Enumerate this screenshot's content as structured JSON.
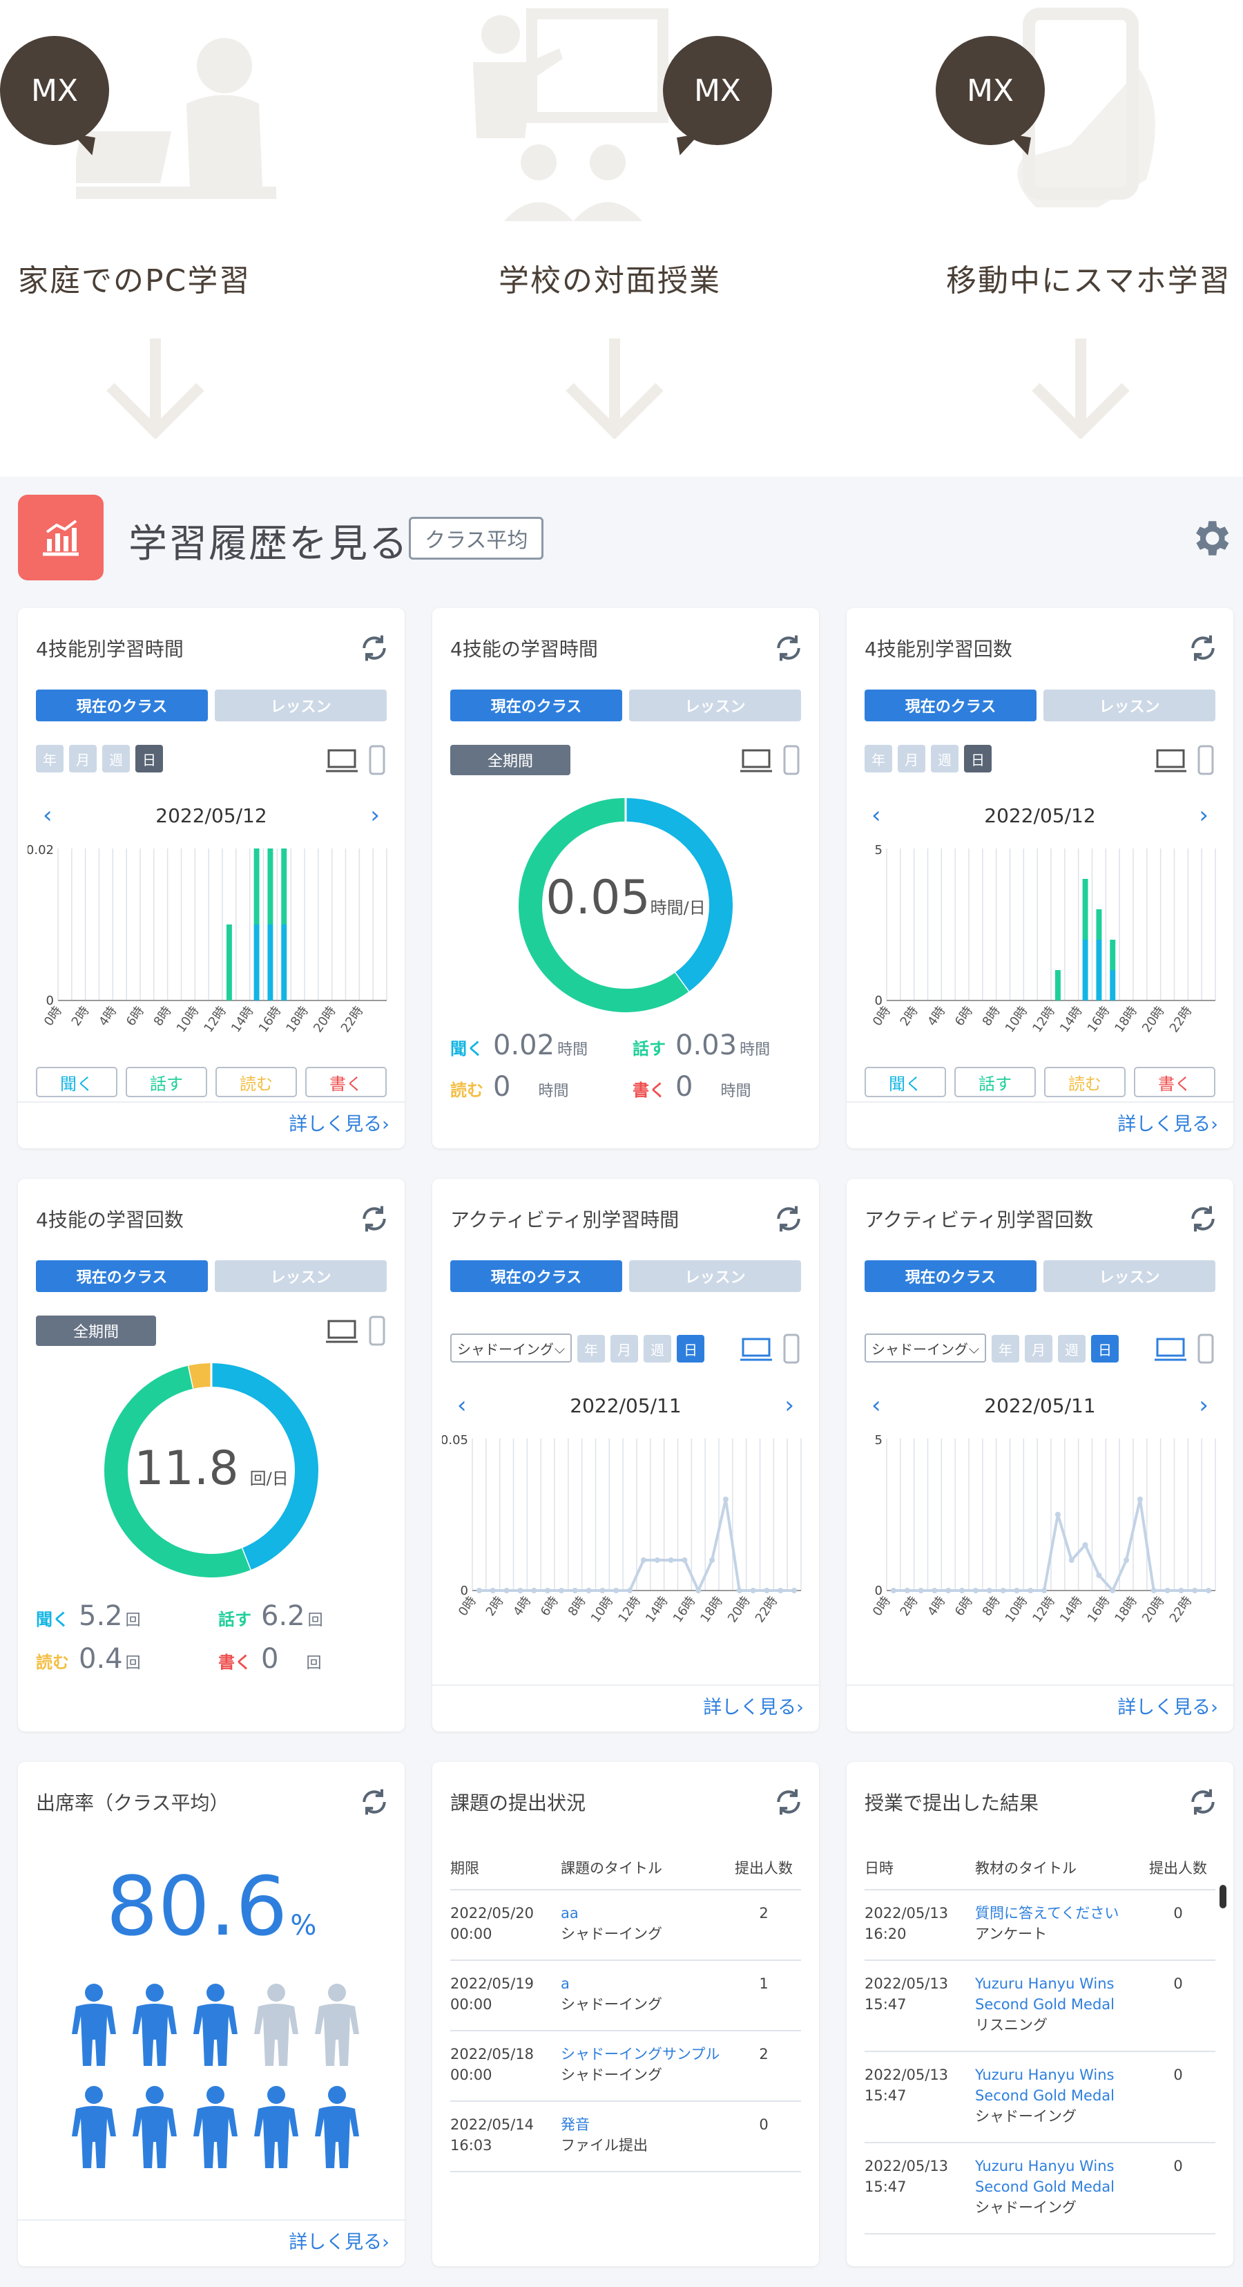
{
  "hero": {
    "columns": [
      {
        "bubble": "MX",
        "title": "家庭でのPC学習"
      },
      {
        "bubble": "MX",
        "title": "学校の対面授業"
      },
      {
        "bubble": "MX",
        "title": "移動中にスマホ学習"
      }
    ]
  },
  "dashboard": {
    "title": "学習履歴を見る",
    "badge": "クラス平均"
  },
  "common": {
    "tab_class": "現在のクラス",
    "tab_lesson": "レッスン",
    "period_year": "年",
    "period_month": "月",
    "period_week": "週",
    "period_day": "日",
    "all_period": "全期間",
    "more": "詳しく見る›",
    "prev": "‹",
    "next": "›",
    "skill_listen": "聞く",
    "skill_speak": "話す",
    "skill_read": "読む",
    "skill_write": "書く",
    "unit_time": "時間",
    "unit_count": "回",
    "hour_labels": [
      "0時",
      "2時",
      "4時",
      "6時",
      "8時",
      "10時",
      "12時",
      "14時",
      "16時",
      "18時",
      "20時",
      "22時"
    ]
  },
  "colors": {
    "listen": "#12b5e4",
    "speak": "#1fcf9a",
    "read": "#f3be43",
    "write": "#ef4f4f",
    "accent": "#2e7fdd"
  },
  "cards": {
    "c1": {
      "title": "4技能別学習時間",
      "date": "2022/05/12",
      "y_max": "0.02",
      "y_min": "0"
    },
    "c2": {
      "title": "4技能の学習時間",
      "center": "0.05",
      "center_unit": "時間/日",
      "listen": "0.02",
      "speak": "0.03",
      "read": "0",
      "write": "0"
    },
    "c3": {
      "title": "4技能別学習回数",
      "date": "2022/05/12",
      "y_max": "5",
      "y_min": "0"
    },
    "c4": {
      "title": "4技能の学習回数",
      "center": "11.8",
      "center_unit": "回/日",
      "listen": "5.2",
      "speak": "6.2",
      "read": "0.4",
      "write": "0"
    },
    "c5": {
      "title": "アクティビティ別学習時間",
      "select": "シャドーイング",
      "date": "2022/05/11",
      "y_max": "0.05",
      "y_min": "0"
    },
    "c6": {
      "title": "アクティビティ別学習回数",
      "select": "シャドーイング",
      "date": "2022/05/11",
      "y_max": "5",
      "y_min": "0"
    },
    "c7": {
      "title": "出席率（クラス平均）",
      "rate": "80.6",
      "rate_unit": "%"
    },
    "c8": {
      "title": "課題の提出状況",
      "headers": [
        "期限",
        "課題のタイトル",
        "提出人数"
      ],
      "rows": [
        {
          "date": "2022/05/20",
          "time": "00:00",
          "title": "aa",
          "type": "シャドーイング",
          "count": "2"
        },
        {
          "date": "2022/05/19",
          "time": "00:00",
          "title": "a",
          "type": "シャドーイング",
          "count": "1"
        },
        {
          "date": "2022/05/18",
          "time": "00:00",
          "title": "シャドーイングサンプル",
          "type": "シャドーイング",
          "count": "2"
        },
        {
          "date": "2022/05/14",
          "time": "16:03",
          "title": "発音",
          "type": "ファイル提出",
          "count": "0"
        }
      ]
    },
    "c9": {
      "title": "授業で提出した結果",
      "headers": [
        "日時",
        "教材のタイトル",
        "提出人数"
      ],
      "rows": [
        {
          "date": "2022/05/13",
          "time": "16:20",
          "title": "質問に答えてください",
          "type": "アンケート",
          "count": "0"
        },
        {
          "date": "2022/05/13",
          "time": "15:47",
          "title": "Yuzuru Hanyu Wins Second Gold Medal",
          "type": "リスニング",
          "count": "0"
        },
        {
          "date": "2022/05/13",
          "time": "15:47",
          "title": "Yuzuru Hanyu Wins Second Gold Medal",
          "type": "シャドーイング",
          "count": "0"
        },
        {
          "date": "2022/05/13",
          "time": "15:47",
          "title": "Yuzuru Hanyu Wins Second Gold Medal",
          "type": "シャドーイング",
          "count": "0"
        }
      ]
    }
  },
  "chart_data": [
    {
      "type": "bar",
      "title": "4技能別学習時間",
      "x": [
        "0時",
        "1時",
        "2時",
        "3時",
        "4時",
        "5時",
        "6時",
        "7時",
        "8時",
        "9時",
        "10時",
        "11時",
        "12時",
        "13時",
        "14時",
        "15時",
        "16時",
        "17時",
        "18時",
        "19時",
        "20時",
        "21時",
        "22時",
        "23時"
      ],
      "series": [
        {
          "name": "聞く",
          "values": [
            0,
            0,
            0,
            0,
            0,
            0,
            0,
            0,
            0,
            0,
            0,
            0,
            0,
            0,
            0.01,
            0.01,
            0.01,
            0,
            0,
            0,
            0,
            0,
            0,
            0
          ]
        },
        {
          "name": "話す",
          "values": [
            0,
            0,
            0,
            0,
            0,
            0,
            0,
            0,
            0,
            0,
            0,
            0,
            0.01,
            0,
            0.01,
            0.01,
            0.01,
            0,
            0,
            0,
            0,
            0,
            0,
            0
          ]
        }
      ],
      "ylim": [
        0,
        0.02
      ]
    },
    {
      "type": "pie",
      "title": "4技能の学習時間",
      "categories": [
        "聞く",
        "話す",
        "読む",
        "書く"
      ],
      "values": [
        0.02,
        0.03,
        0,
        0
      ]
    },
    {
      "type": "bar",
      "title": "4技能別学習回数",
      "x": [
        "0時",
        "1時",
        "2時",
        "3時",
        "4時",
        "5時",
        "6時",
        "7時",
        "8時",
        "9時",
        "10時",
        "11時",
        "12時",
        "13時",
        "14時",
        "15時",
        "16時",
        "17時",
        "18時",
        "19時",
        "20時",
        "21時",
        "22時",
        "23時"
      ],
      "series": [
        {
          "name": "聞く",
          "values": [
            0,
            0,
            0,
            0,
            0,
            0,
            0,
            0,
            0,
            0,
            0,
            0,
            0,
            0,
            2,
            2,
            1,
            0,
            0,
            0,
            0,
            0,
            0,
            0
          ]
        },
        {
          "name": "話す",
          "values": [
            0,
            0,
            0,
            0,
            0,
            0,
            0,
            0,
            0,
            0,
            0,
            0,
            1,
            0,
            2,
            1,
            1,
            0,
            0,
            0,
            0,
            0,
            0,
            0
          ]
        }
      ],
      "ylim": [
        0,
        5
      ]
    },
    {
      "type": "pie",
      "title": "4技能の学習回数",
      "categories": [
        "聞く",
        "話す",
        "読む",
        "書く"
      ],
      "values": [
        5.2,
        6.2,
        0.4,
        0
      ]
    },
    {
      "type": "line",
      "title": "アクティビティ別学習時間",
      "x": [
        "0時",
        "1時",
        "2時",
        "3時",
        "4時",
        "5時",
        "6時",
        "7時",
        "8時",
        "9時",
        "10時",
        "11時",
        "12時",
        "13時",
        "14時",
        "15時",
        "16時",
        "17時",
        "18時",
        "19時",
        "20時",
        "21時",
        "22時",
        "23時"
      ],
      "values": [
        0,
        0,
        0,
        0,
        0,
        0,
        0,
        0,
        0,
        0,
        0,
        0,
        0.01,
        0.01,
        0.01,
        0.01,
        0,
        0.01,
        0.03,
        0,
        0,
        0,
        0,
        0
      ],
      "ylim": [
        0,
        0.05
      ]
    },
    {
      "type": "line",
      "title": "アクティビティ別学習回数",
      "x": [
        "0時",
        "1時",
        "2時",
        "3時",
        "4時",
        "5時",
        "6時",
        "7時",
        "8時",
        "9時",
        "10時",
        "11時",
        "12時",
        "13時",
        "14時",
        "15時",
        "16時",
        "17時",
        "18時",
        "19時",
        "20時",
        "21時",
        "22時",
        "23時"
      ],
      "values": [
        0,
        0,
        0,
        0,
        0,
        0,
        0,
        0,
        0,
        0,
        0,
        0,
        2.5,
        1,
        1.5,
        0.5,
        0,
        1,
        3,
        0,
        0,
        0,
        0,
        0
      ],
      "ylim": [
        0,
        5
      ]
    }
  ]
}
